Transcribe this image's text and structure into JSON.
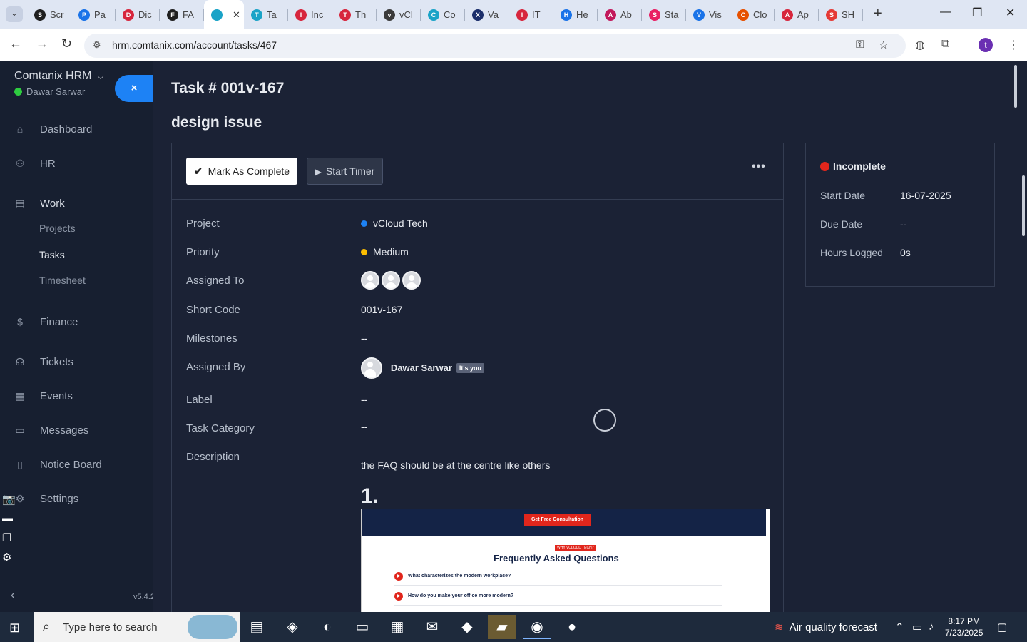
{
  "browser": {
    "tabs": [
      {
        "label": "Scr",
        "color": "#1f1f1f",
        "icon": "S"
      },
      {
        "label": "Pa",
        "color": "#1a73e8",
        "icon": "P"
      },
      {
        "label": "Dic",
        "color": "#d7263d",
        "icon": "D"
      },
      {
        "label": "FA",
        "color": "#1f1f1f",
        "icon": "F"
      },
      {
        "label": "",
        "color": "#1aa3c7",
        "icon": "",
        "active": true
      },
      {
        "label": "Ta",
        "color": "#1aa3c7",
        "icon": "T"
      },
      {
        "label": "Inc",
        "color": "#d7263d",
        "icon": "I"
      },
      {
        "label": "Th",
        "color": "#d7263d",
        "icon": "T"
      },
      {
        "label": "vCl",
        "color": "#3a3a3a",
        "icon": "v"
      },
      {
        "label": "Co",
        "color": "#1aa3c7",
        "icon": "C"
      },
      {
        "label": "Va",
        "color": "#1c2f6b",
        "icon": "X"
      },
      {
        "label": "IT",
        "color": "#d7263d",
        "icon": "I"
      },
      {
        "label": "He",
        "color": "#1a73e8",
        "icon": "H"
      },
      {
        "label": "Ab",
        "color": "#c2185b",
        "icon": "A"
      },
      {
        "label": "Sta",
        "color": "#e91e63",
        "icon": "S"
      },
      {
        "label": "Vis",
        "color": "#1a73e8",
        "icon": "V"
      },
      {
        "label": "Clo",
        "color": "#e65100",
        "icon": "C"
      },
      {
        "label": "Ap",
        "color": "#d7263d",
        "icon": "A"
      },
      {
        "label": "SH",
        "color": "#e53935",
        "icon": "S"
      }
    ],
    "new_tab": "+",
    "window_controls": {
      "minimize": "—",
      "maximize": "❐",
      "close": "✕"
    },
    "url": "hrm.comtanix.com/account/tasks/467",
    "icons": [
      "tune-icon",
      "key-icon",
      "star-icon",
      "translate-icon",
      "extensions-icon",
      "profile-icon",
      "menu-icon"
    ],
    "profile_initial": "t"
  },
  "sidebar": {
    "brand": "Comtanix HRM",
    "user": "Dawar Sarwar",
    "close_symbol": "×",
    "items": [
      {
        "label": "Dashboard",
        "icon": "⌂"
      },
      {
        "label": "HR",
        "icon": "⚇"
      },
      {
        "label": "Work",
        "icon": "▤"
      },
      {
        "label": "Finance",
        "icon": "$"
      },
      {
        "label": "Tickets",
        "icon": "☊"
      },
      {
        "label": "Events",
        "icon": "▦"
      },
      {
        "label": "Messages",
        "icon": "▭"
      },
      {
        "label": "Notice Board",
        "icon": "▯"
      },
      {
        "label": "Settings",
        "icon": "⚙"
      }
    ],
    "work_sub": [
      {
        "label": "Projects"
      },
      {
        "label": "Tasks"
      },
      {
        "label": "Timesheet"
      }
    ],
    "version": "v5.4.2"
  },
  "task": {
    "title": "Task # 001v-167",
    "heading": "design issue",
    "mark_complete": "Mark As Complete",
    "start_timer": "Start Timer",
    "more": "•••",
    "fields": {
      "project_label": "Project",
      "project": "vCloud Tech",
      "project_color": "#1d82f5",
      "priority_label": "Priority",
      "priority": "Medium",
      "priority_color": "#fcbd01",
      "assigned_to_label": "Assigned To",
      "short_code_label": "Short Code",
      "short_code": "001v-167",
      "milestones_label": "Milestones",
      "milestones": "--",
      "assigned_by_label": "Assigned By",
      "assigned_by": "Dawar Sarwar",
      "its_you": "It's you",
      "label_label": "Label",
      "label": "--",
      "category_label": "Task Category",
      "category": "--",
      "description_label": "Description"
    },
    "description": {
      "text": "the FAQ should be at the centre like others",
      "heading": "1.",
      "screenshot": {
        "button": "Get Free Consultation",
        "tag": "WHY VCLOUD TECH?",
        "title": "Frequently Asked Questions",
        "questions": [
          "What characterizes the modern workplace?",
          "How do you make your office more modern?"
        ]
      }
    }
  },
  "status": {
    "state": "Incomplete",
    "start_date_label": "Start Date",
    "start_date": "16-07-2025",
    "due_date_label": "Due Date",
    "due_date": "--",
    "hours_label": "Hours Logged",
    "hours": "0s"
  },
  "taskbar": {
    "search_placeholder": "Type here to search",
    "weather": "Air quality forecast",
    "time": "8:17 PM",
    "date": "7/23/2025"
  }
}
